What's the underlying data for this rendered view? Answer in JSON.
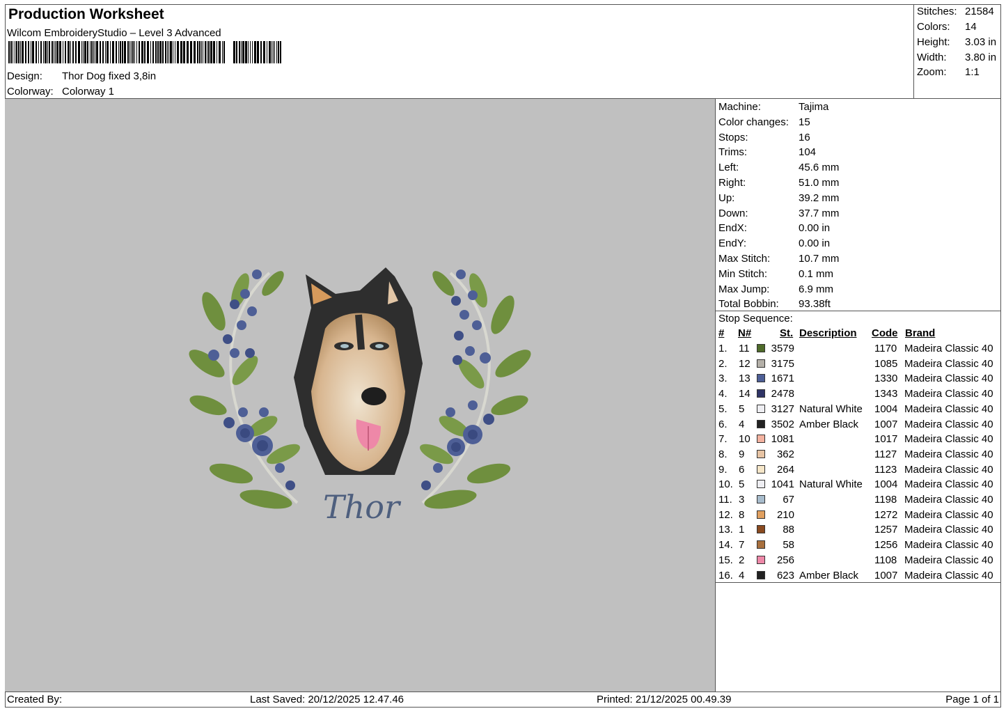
{
  "header": {
    "title": "Production Worksheet",
    "software": "Wilcom EmbroideryStudio – Level 3 Advanced",
    "design_label": "Design:",
    "design_value": "Thor Dog  fixed 3,8in",
    "colorway_label": "Colorway:",
    "colorway_value": "Colorway 1"
  },
  "stats": [
    {
      "label": "Stitches:",
      "value": "21584"
    },
    {
      "label": "Colors:",
      "value": "14"
    },
    {
      "label": "Height:",
      "value": "3.03 in"
    },
    {
      "label": "Width:",
      "value": "3.80 in"
    },
    {
      "label": "Zoom:",
      "value": "1:1"
    }
  ],
  "machine_info": [
    {
      "label": "Machine:",
      "value": "Tajima"
    },
    {
      "label": "Color changes:",
      "value": "15"
    },
    {
      "label": "Stops:",
      "value": "16"
    },
    {
      "label": "Trims:",
      "value": "104"
    },
    {
      "label": "Left:",
      "value": "45.6 mm"
    },
    {
      "label": "Right:",
      "value": "51.0 mm"
    },
    {
      "label": "Up:",
      "value": "39.2 mm"
    },
    {
      "label": "Down:",
      "value": "37.7 mm"
    },
    {
      "label": "EndX:",
      "value": "0.00 in"
    },
    {
      "label": "EndY:",
      "value": "0.00 in"
    },
    {
      "label": "Max Stitch:",
      "value": "10.7 mm"
    },
    {
      "label": "Min Stitch:",
      "value": "0.1 mm"
    },
    {
      "label": "Max Jump:",
      "value": "6.9 mm"
    },
    {
      "label": "Total Bobbin:",
      "value": "93.38ft"
    }
  ],
  "stop_sequence": {
    "title": "Stop Sequence:",
    "headers": {
      "num": "#",
      "n": "N#",
      "st": "St.",
      "desc": "Description",
      "code": "Code",
      "brand": "Brand"
    },
    "rows": [
      {
        "num": "1.",
        "n": "11",
        "st": "3579",
        "desc": "",
        "code": "1170",
        "brand": "Madeira Classic 40",
        "color": "#4f6b2a"
      },
      {
        "num": "2.",
        "n": "12",
        "st": "3175",
        "desc": "",
        "code": "1085",
        "brand": "Madeira Classic 40",
        "color": "#b4b0a8"
      },
      {
        "num": "3.",
        "n": "13",
        "st": "1671",
        "desc": "",
        "code": "1330",
        "brand": "Madeira Classic 40",
        "color": "#4e5f96"
      },
      {
        "num": "4.",
        "n": "14",
        "st": "2478",
        "desc": "",
        "code": "1343",
        "brand": "Madeira Classic 40",
        "color": "#2f3466"
      },
      {
        "num": "5.",
        "n": "5",
        "st": "3127",
        "desc": "Natural White",
        "code": "1004",
        "brand": "Madeira Classic 40",
        "color": "#eeeef2"
      },
      {
        "num": "6.",
        "n": "4",
        "st": "3502",
        "desc": "Amber Black",
        "code": "1007",
        "brand": "Madeira Classic 40",
        "color": "#222222"
      },
      {
        "num": "7.",
        "n": "10",
        "st": "1081",
        "desc": "",
        "code": "1017",
        "brand": "Madeira Classic 40",
        "color": "#f3b2a0"
      },
      {
        "num": "8.",
        "n": "9",
        "st": "362",
        "desc": "",
        "code": "1127",
        "brand": "Madeira Classic 40",
        "color": "#e7c4a4"
      },
      {
        "num": "9.",
        "n": "6",
        "st": "264",
        "desc": "",
        "code": "1123",
        "brand": "Madeira Classic 40",
        "color": "#f5e6c8"
      },
      {
        "num": "10.",
        "n": "5",
        "st": "1041",
        "desc": "Natural White",
        "code": "1004",
        "brand": "Madeira Classic 40",
        "color": "#eeeef2"
      },
      {
        "num": "11.",
        "n": "3",
        "st": "67",
        "desc": "",
        "code": "1198",
        "brand": "Madeira Classic 40",
        "color": "#a8bccc"
      },
      {
        "num": "12.",
        "n": "8",
        "st": "210",
        "desc": "",
        "code": "1272",
        "brand": "Madeira Classic 40",
        "color": "#e0a060"
      },
      {
        "num": "13.",
        "n": "1",
        "st": "88",
        "desc": "",
        "code": "1257",
        "brand": "Madeira Classic 40",
        "color": "#8a4a20"
      },
      {
        "num": "14.",
        "n": "7",
        "st": "58",
        "desc": "",
        "code": "1256",
        "brand": "Madeira Classic 40",
        "color": "#a8703e"
      },
      {
        "num": "15.",
        "n": "2",
        "st": "256",
        "desc": "",
        "code": "1108",
        "brand": "Madeira Classic 40",
        "color": "#ee88a8"
      },
      {
        "num": "16.",
        "n": "4",
        "st": "623",
        "desc": "Amber Black",
        "code": "1007",
        "brand": "Madeira Classic 40",
        "color": "#222222"
      }
    ]
  },
  "design_text": "Thor",
  "footer": {
    "created_by": "Created By:",
    "last_saved": "Last Saved: 20/12/2025 12.47.46",
    "printed": "Printed: 21/12/2025 00.49.39",
    "page": "Page 1 of 1"
  }
}
